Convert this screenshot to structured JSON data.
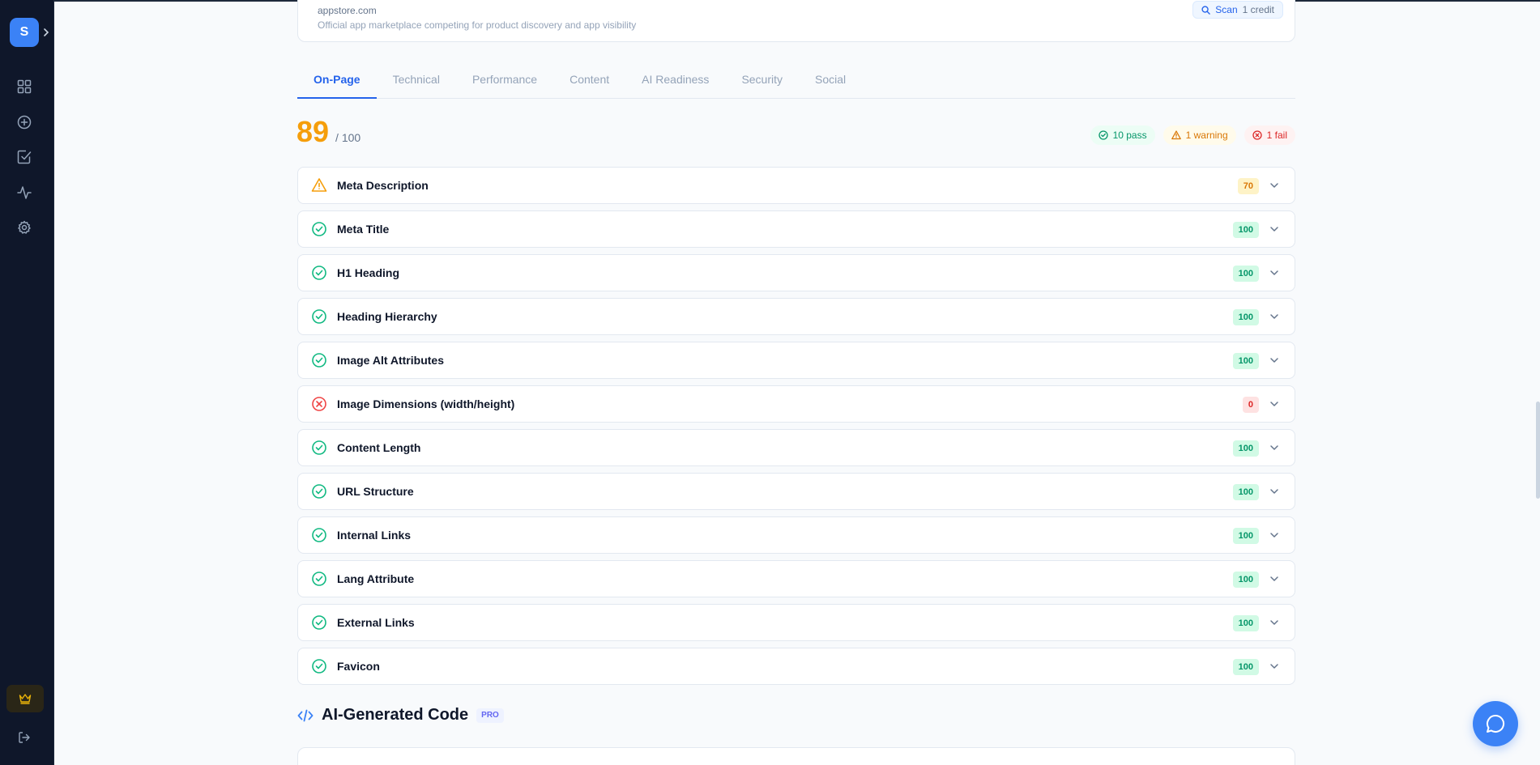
{
  "user": {
    "avatar_initial": "S"
  },
  "header": {
    "domain": "appstore.com",
    "description": "Official app marketplace competing for product discovery and app visibility",
    "scan_label": "Scan",
    "scan_cost": "1 credit"
  },
  "tabs": [
    {
      "label": "On-Page",
      "active": true
    },
    {
      "label": "Technical",
      "active": false
    },
    {
      "label": "Performance",
      "active": false
    },
    {
      "label": "Content",
      "active": false
    },
    {
      "label": "AI Readiness",
      "active": false
    },
    {
      "label": "Security",
      "active": false
    },
    {
      "label": "Social",
      "active": false
    }
  ],
  "score": {
    "value": "89",
    "max": "/ 100"
  },
  "summary": {
    "pass": "10 pass",
    "warning": "1 warning",
    "fail": "1 fail"
  },
  "checks": [
    {
      "label": "Meta Description",
      "score": "70",
      "status": "warning"
    },
    {
      "label": "Meta Title",
      "score": "100",
      "status": "pass"
    },
    {
      "label": "H1 Heading",
      "score": "100",
      "status": "pass"
    },
    {
      "label": "Heading Hierarchy",
      "score": "100",
      "status": "pass"
    },
    {
      "label": "Image Alt Attributes",
      "score": "100",
      "status": "pass"
    },
    {
      "label": "Image Dimensions (width/height)",
      "score": "0",
      "status": "fail"
    },
    {
      "label": "Content Length",
      "score": "100",
      "status": "pass"
    },
    {
      "label": "URL Structure",
      "score": "100",
      "status": "pass"
    },
    {
      "label": "Internal Links",
      "score": "100",
      "status": "pass"
    },
    {
      "label": "Lang Attribute",
      "score": "100",
      "status": "pass"
    },
    {
      "label": "External Links",
      "score": "100",
      "status": "pass"
    },
    {
      "label": "Favicon",
      "score": "100",
      "status": "pass"
    }
  ],
  "ai_section": {
    "title": "AI-Generated Code",
    "badge": "PRO"
  },
  "colors": {
    "accent": "#3b82f6",
    "pass": "#10b981",
    "warning": "#f59e0b",
    "fail": "#ef4444",
    "sidebar": "#0f172a"
  }
}
